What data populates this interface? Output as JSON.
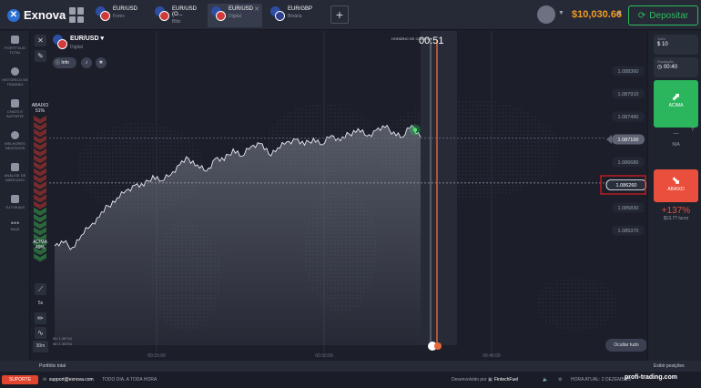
{
  "topbar": {
    "brand": "Exnova",
    "tabs": [
      {
        "asset": "EUR/USD",
        "type": "Forex"
      },
      {
        "asset": "EUR/USD (O...",
        "type": "Blitz"
      },
      {
        "asset": "EUR/USD",
        "type": "Digital"
      },
      {
        "asset": "EUR/GBP",
        "type": "Binária"
      }
    ],
    "balance": "$10,030.66",
    "deposit_label": "Depositar"
  },
  "sidebar": [
    {
      "label": "PORTFÓLIO TOTAL",
      "icon": "briefcase-icon"
    },
    {
      "label": "HISTÓRICO DE TRADING",
      "icon": "clock-icon"
    },
    {
      "label": "CHATS E SUPORTE",
      "icon": "chat-icon"
    },
    {
      "label": "MELHORES NEGÓCIOS",
      "icon": "trophy-icon"
    },
    {
      "label": "ANÁLISE DE MERCADO",
      "icon": "news-icon"
    },
    {
      "label": "TUTORIAIS",
      "icon": "graduation-cap-icon"
    },
    {
      "label": "MAIS",
      "icon": "more-dots-icon"
    }
  ],
  "chart_header": {
    "asset": "EUR/USD",
    "type": "Digital",
    "info_label": "Info",
    "purchase_label": "HORÁRIO DE COMPRA",
    "timer": "00:51"
  },
  "sentiment": {
    "down_label": "ABAIXO",
    "down_pct": "51%",
    "up_label": "ACIMA",
    "up_pct": "49%"
  },
  "chart_tools": {
    "timeframe": "30m",
    "candle": "5s"
  },
  "chart_data": {
    "type": "area",
    "y_ticks": [
      "1.088360",
      "1.087910",
      "1.087490",
      "1.087100",
      "1.086680",
      "1.086260",
      "1.085830",
      "1.085370"
    ],
    "x_ticks": [
      "00:15:00",
      "00:30:00",
      "00:45:00"
    ],
    "current_price": "1.086260",
    "strike_price": "1.087100",
    "series": [
      {
        "values": [
          1.08508,
          1.08514,
          1.08505,
          1.08528,
          1.08545,
          1.08562,
          1.08583,
          1.08598,
          1.08612,
          1.08622,
          1.0862,
          1.0864,
          1.0863,
          1.08641,
          1.0866,
          1.08672,
          1.0866,
          1.08648,
          1.08672,
          1.08668,
          1.0869,
          1.08676,
          1.08694,
          1.087,
          1.0868,
          1.08692,
          1.08703,
          1.08708,
          1.08697,
          1.0871,
          1.08698,
          1.08715,
          1.08705,
          1.08718,
          1.08728,
          1.08714,
          1.08725,
          1.0873,
          1.08722,
          1.08712,
          1.08734,
          1.08712
        ]
      }
    ]
  },
  "chart_footer": {
    "max_label": "Mx 1.08716",
    "min_label": "Mn 1.08704",
    "hide_all": "Ocultar tudo"
  },
  "panel": {
    "value_label": "Valor",
    "value": "$ 10",
    "expiry_label": "Expiração",
    "expiry": "00:40",
    "up_label": "ACIMA",
    "neutral_value": "—",
    "neutral_label": "N/A",
    "down_label": "ABAIXO",
    "payout": "+137%",
    "profit": "$13.77 lucro"
  },
  "bottombar": {
    "portfolio": "Portfólio total",
    "positions": "Exibir posições"
  },
  "statusbar": {
    "support_label": "SUPORTE",
    "email": "support@exnova.com",
    "hours": "TODO DIA, A TODA HORA",
    "developed": "Desenvolvido por",
    "developer": "FintechFuel",
    "time": "HORA ATUAL: 2 DEZEMBRO",
    "watermark": "profi-trading.com"
  }
}
